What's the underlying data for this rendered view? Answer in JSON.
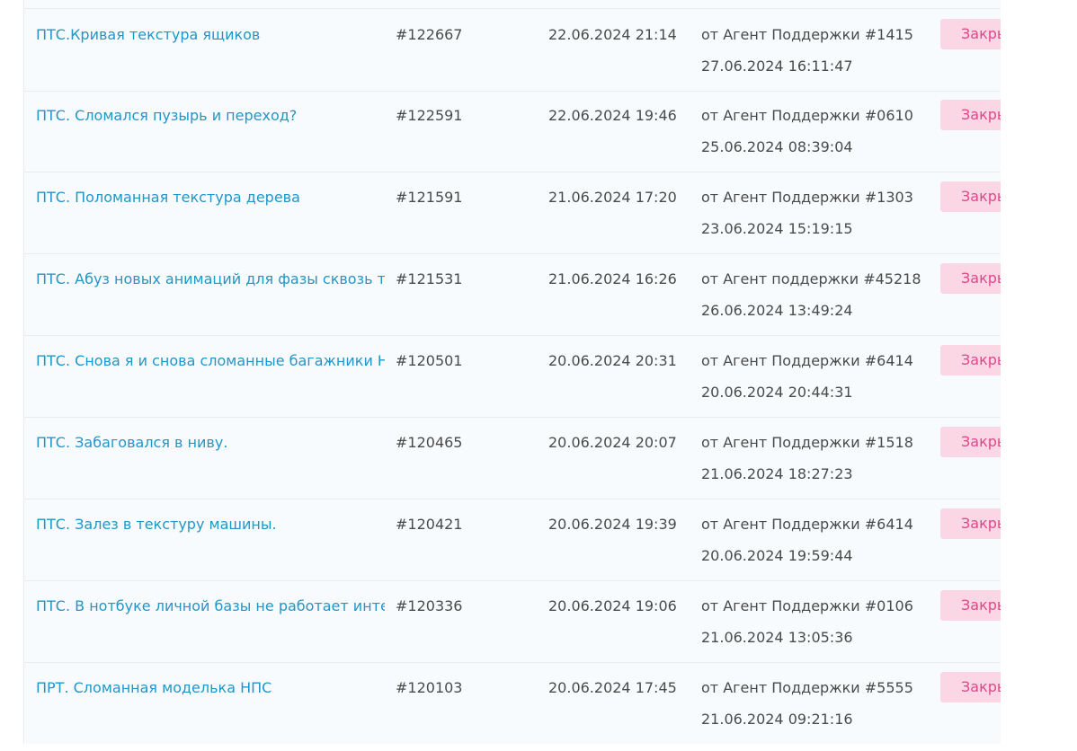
{
  "tickets": [
    {
      "title": "ПТС.Кривая текстура ящиков",
      "number": "#122667",
      "created": "22.06.2024 21:14",
      "agent": "от Агент Поддержки #1415",
      "updated": "27.06.2024 16:11:47",
      "status": "Закрыт"
    },
    {
      "title": "ПТС. Сломался пузырь и переход?",
      "number": "#122591",
      "created": "22.06.2024 19:46",
      "agent": "от Агент Поддержки #0610",
      "updated": "25.06.2024 08:39:04",
      "status": "Закрыт"
    },
    {
      "title": "ПТС. Поломанная текстура дерева",
      "number": "#121591",
      "created": "21.06.2024 17:20",
      "agent": "от Агент Поддержки #1303",
      "updated": "23.06.2024 15:19:15",
      "status": "Закрыт"
    },
    {
      "title": "ПТС. Абуз новых анимаций для фазы сквозь текстуры",
      "number": "#121531",
      "created": "21.06.2024 16:26",
      "agent": "от Агент поддержки #45218",
      "updated": "26.06.2024 13:49:24",
      "status": "Закрыт"
    },
    {
      "title": "ПТС. Снова я и снова сломанные багажники НПС",
      "number": "#120501",
      "created": "20.06.2024 20:31",
      "agent": "от Агент Поддержки #6414",
      "updated": "20.06.2024 20:44:31",
      "status": "Закрыт"
    },
    {
      "title": "ПТС. Забаговался в ниву.",
      "number": "#120465",
      "created": "20.06.2024 20:07",
      "agent": "от Агент Поддержки #1518",
      "updated": "21.06.2024 18:27:23",
      "status": "Закрыт"
    },
    {
      "title": "ПТС. Залез в текстуру машины.",
      "number": "#120421",
      "created": "20.06.2024 19:39",
      "agent": "от Агент Поддержки #6414",
      "updated": "20.06.2024 19:59:44",
      "status": "Закрыт"
    },
    {
      "title": "ПТС. В нотбуке личной базы не работает интернет",
      "number": "#120336",
      "created": "20.06.2024 19:06",
      "agent": "от Агент Поддержки #0106",
      "updated": "21.06.2024 13:05:36",
      "status": "Закрыт"
    },
    {
      "title": "ПРТ. Сломанная моделька НПС",
      "number": "#120103",
      "created": "20.06.2024 17:45",
      "agent": "от Агент Поддержки #5555",
      "updated": "21.06.2024 09:21:16",
      "status": "Закрыт"
    }
  ]
}
